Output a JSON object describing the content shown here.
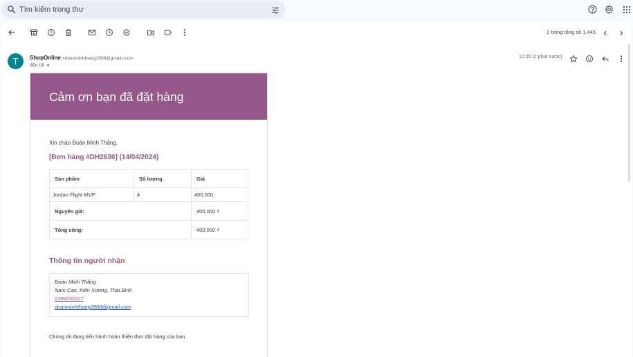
{
  "search": {
    "placeholder": "Tìm kiếm trong thư"
  },
  "toolbar": {
    "pager": "2 trong tổng số 1.445"
  },
  "message": {
    "avatar_letter": "T",
    "sender_name": "ShopOnline",
    "sender_email": "<doanminhthang2808@gmail.com>",
    "to": "đến tôi",
    "time": "12:05 (2 phút trước)"
  },
  "email": {
    "banner_title": "Cảm ơn bạn đã đặt hàng",
    "greeting": "Xin chào Đoàn Minh Thắng,",
    "order_heading": "[Đơn hàng #DH2636] (14/04/2024)",
    "table": {
      "headers": [
        "Sản phẩm",
        "Số lượng",
        "Giá"
      ],
      "items": [
        {
          "product": "Jordan Flight MVP",
          "qty": "4",
          "price": "400,000"
        }
      ],
      "subtotal_label": "Nguyên giá:",
      "subtotal_value": "400,000 ₫",
      "total_label": "Tổng cộng:",
      "total_value": "400,000 ₫"
    },
    "recipient_heading": "Thông tin người nhận",
    "recipient": {
      "name": "Đoàn Minh Thắng",
      "address": "Nam Cao, Kiến Xương, Thái Bình",
      "phone": "0386050327",
      "email": "doanminhthang2808@gmail.com"
    },
    "footer": "Chúng tôi đang tiến hành hoàn thiện đơn đặt hàng của bạn"
  },
  "colors": {
    "accent": "#96588a",
    "avatar": "#00838f",
    "search_bg": "#e9eef6"
  }
}
